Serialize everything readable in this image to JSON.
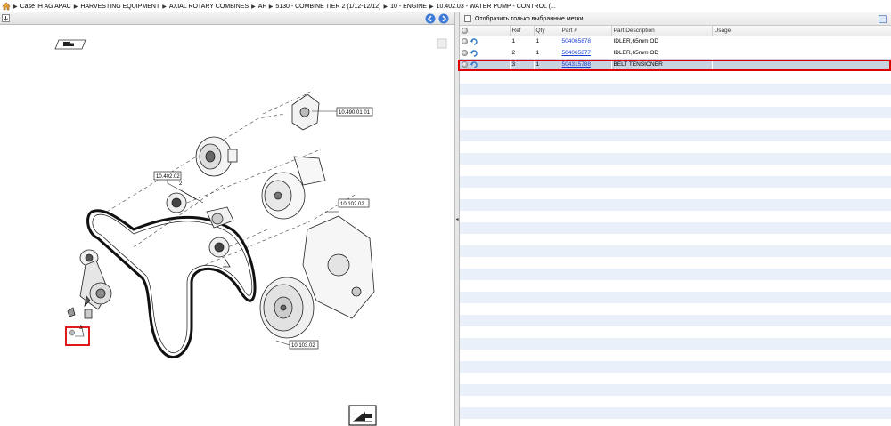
{
  "breadcrumb": [
    "Case IH AG APAC",
    "HARVESTING EQUIPMENT",
    "AXIAL ROTARY COMBINES",
    "AF",
    "5130 - COMBINE TIER 2 (1/12-12/12)",
    "10 - ENGINE",
    "10.402.03 - WATER PUMP - CONTROL (..."
  ],
  "filter": {
    "label": "Отобразить только выбранные метки"
  },
  "table": {
    "headers": {
      "ref": "Ref",
      "qty": "Qty",
      "part": "Part #",
      "desc": "Part Description",
      "usage": "Usage"
    },
    "rows": [
      {
        "ref": "1",
        "qty": "1",
        "part": "504065878",
        "desc": "IDLER,65mm OD",
        "usage": ""
      },
      {
        "ref": "2",
        "qty": "1",
        "part": "504065877",
        "desc": "IDLER,65mm OD",
        "usage": ""
      },
      {
        "ref": "3",
        "qty": "1",
        "part": "504315788",
        "desc": "BELT TENSIONER",
        "usage": ""
      }
    ]
  },
  "diagram": {
    "labels": {
      "ref1": "10.490.01 01",
      "ref2": "10.402.02",
      "ref3": "10.102.02",
      "ref4": "10.103.02",
      "callout1": "1",
      "callout2": "2",
      "callout3": "3"
    }
  },
  "colors": {
    "highlight": "#dd0000",
    "link": "#1a3fd6",
    "stripe": "#eaf0fa",
    "selected": "#c9d2e0"
  }
}
